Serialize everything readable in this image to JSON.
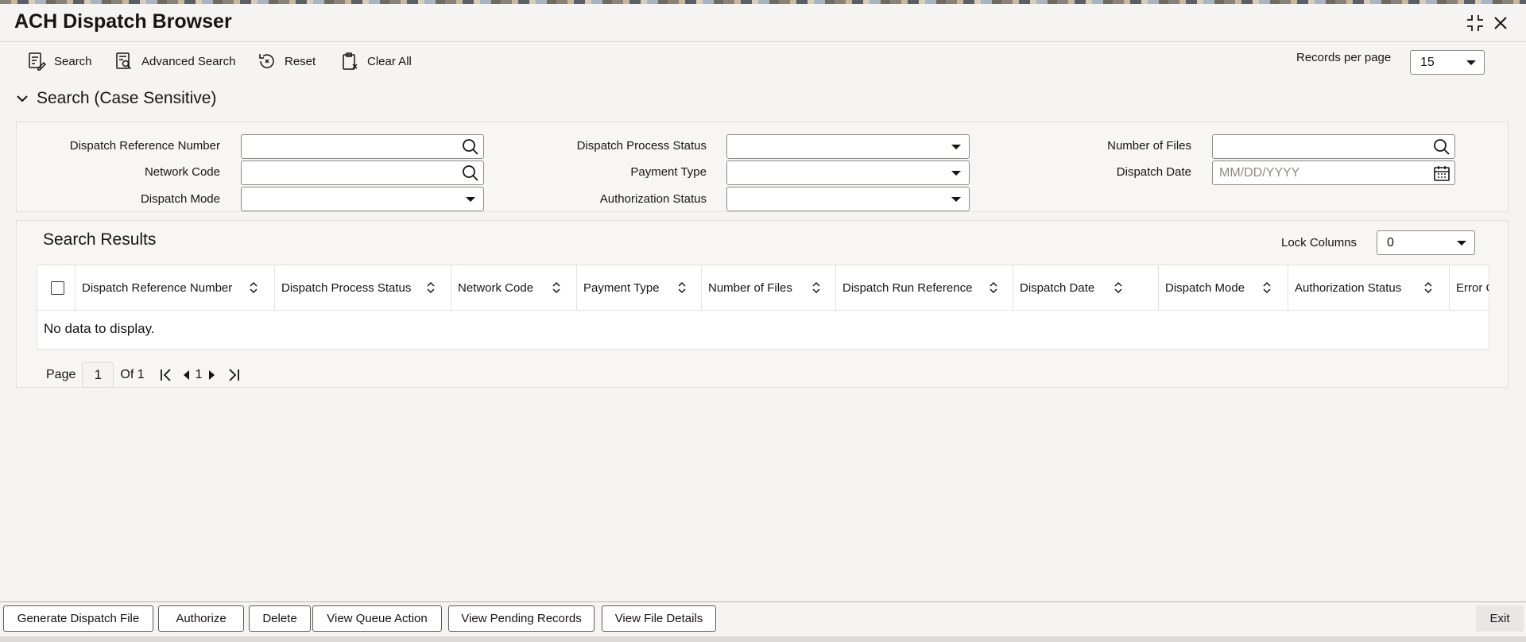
{
  "window": {
    "title": "ACH Dispatch Browser",
    "minimize_icon": "collapse-icon",
    "close_icon": "close-icon"
  },
  "toolbar": {
    "search_label": "Search",
    "advanced_search_label": "Advanced Search",
    "reset_label": "Reset",
    "clear_all_label": "Clear All",
    "records_per_page_label": "Records per page",
    "records_per_page_value": "15"
  },
  "search_section": {
    "title": "Search (Case Sensitive)",
    "fields": {
      "dispatch_reference_number": {
        "label": "Dispatch Reference Number",
        "value": ""
      },
      "network_code": {
        "label": "Network Code",
        "value": ""
      },
      "dispatch_mode": {
        "label": "Dispatch Mode",
        "value": ""
      },
      "dispatch_process_status": {
        "label": "Dispatch Process Status",
        "value": ""
      },
      "payment_type": {
        "label": "Payment Type",
        "value": ""
      },
      "authorization_status": {
        "label": "Authorization Status",
        "value": ""
      },
      "number_of_files": {
        "label": "Number of Files",
        "value": ""
      },
      "dispatch_date": {
        "label": "Dispatch Date",
        "value": "",
        "placeholder": "MM/DD/YYYY"
      }
    }
  },
  "results": {
    "title": "Search Results",
    "lock_columns_label": "Lock Columns",
    "lock_columns_value": "0",
    "columns": [
      "Dispatch Reference Number",
      "Dispatch Process Status",
      "Network Code",
      "Payment Type",
      "Number of Files",
      "Dispatch Run Reference",
      "Dispatch Date",
      "Dispatch Mode",
      "Authorization Status",
      "Error C"
    ],
    "rows": [],
    "empty_message": "No data to display."
  },
  "pager": {
    "page_label": "Page",
    "current_page": "1",
    "of_label": "Of 1",
    "page_number": "1"
  },
  "footer": {
    "buttons": [
      "Generate Dispatch File",
      "Authorize",
      "Delete",
      "View Queue Action",
      "View Pending Records",
      "View File Details"
    ],
    "exit_label": "Exit"
  },
  "colors": {
    "background": "#f5f4f2",
    "panel": "#f7f6f4",
    "border": "#8d8a85",
    "text": "#161513"
  }
}
